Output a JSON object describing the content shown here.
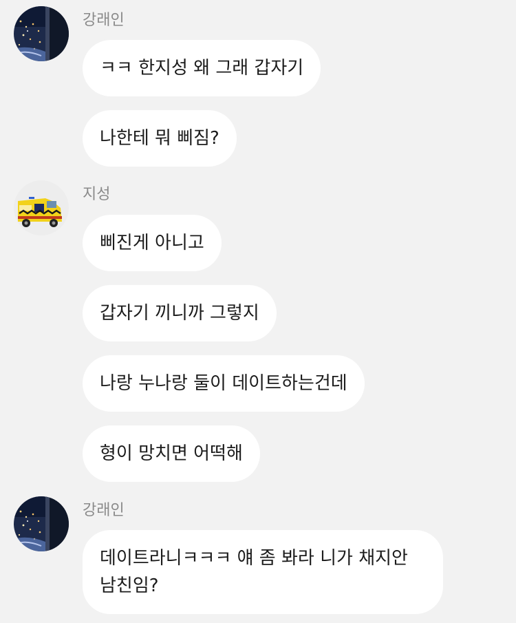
{
  "groups": [
    {
      "sender": "강래인",
      "avatar": "night-city-avatar-icon",
      "messages": [
        "ㅋㅋ 한지성 왜 그래 갑자기",
        "나한테 뭐 삐짐?"
      ]
    },
    {
      "sender": "지성",
      "avatar": "ambulance-avatar-icon",
      "messages": [
        "삐진게 아니고",
        "갑자기 끼니까 그렇지",
        "나랑 누나랑 둘이 데이트하는건데",
        "형이 망치면 어떡해"
      ]
    },
    {
      "sender": "강래인",
      "avatar": "night-city-avatar-icon",
      "messages": [
        "데이트라니ㅋㅋㅋ 얘 좀 봐라 니가 채지안\n남친임?"
      ]
    }
  ],
  "colors": {
    "background": "#f2f2f2",
    "bubble": "#ffffff",
    "sender_name": "#8a8a8a",
    "text": "#1b1b1b"
  }
}
